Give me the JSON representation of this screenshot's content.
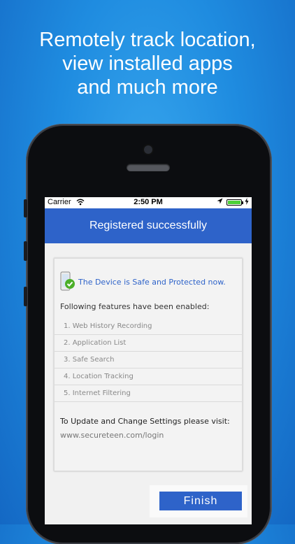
{
  "headline": {
    "line1": "Remotely track location,",
    "line2": "view installed apps",
    "line3": "and much more"
  },
  "status_bar": {
    "carrier": "Carrier",
    "time": "2:50 PM",
    "battery_level": 1.0
  },
  "header": {
    "title": "Registered successfully"
  },
  "card": {
    "protected_message": "The Device is Safe and Protected now.",
    "features_heading": "Following features have been enabled:",
    "features": [
      "1. Web History Recording",
      "2. Application List",
      "3. Safe Search",
      "4. Location Tracking",
      "5. Internet Filtering"
    ],
    "visit_text": "To Update and Change Settings please visit:",
    "visit_link": "www.secureteen.com/login"
  },
  "footer": {
    "finish_label": "Finish"
  },
  "colors": {
    "accent": "#2e63c9",
    "background": "#1f8ce0",
    "check_green": "#4caf28"
  }
}
